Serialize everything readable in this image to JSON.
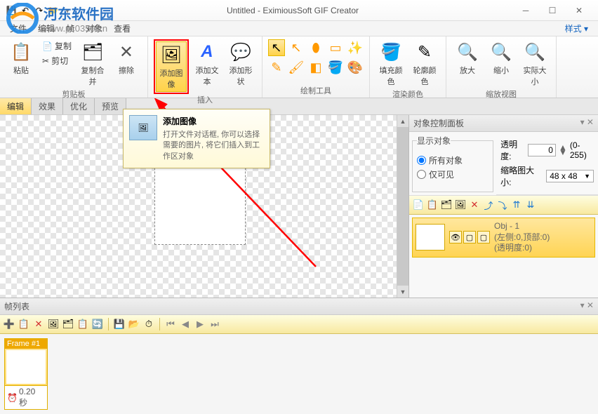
{
  "window": {
    "title": "Untitled - EximiousSoft GIF Creator",
    "style_menu": "样式 ▾"
  },
  "watermark": {
    "site": "河东软件园",
    "url": "www.pc0359.cn"
  },
  "menu": {
    "file": "文件",
    "edit": "编辑",
    "frame": "帧",
    "object": "对象",
    "view": "查看"
  },
  "ribbon": {
    "paste": "粘贴",
    "copy": "复制",
    "cut": "剪切",
    "merge": "复制合并",
    "clear": "擦除",
    "add_image": "添加图像",
    "add_text": "添加文本",
    "add_shape": "添加形状",
    "fill_color": "填充颜色",
    "outline_color": "轮廓颜色",
    "zoom_in": "放大",
    "zoom_out": "缩小",
    "actual_size": "实际大小",
    "group_clipboard": "剪贴板",
    "group_insert": "插入",
    "group_draw": "绘制工具",
    "group_color": "渲染颜色",
    "group_zoom": "缩放视图"
  },
  "tabs": {
    "edit": "编辑",
    "effect": "效果",
    "optimize": "优化",
    "preview": "预览"
  },
  "tooltip": {
    "title": "添加图像",
    "desc": "打开文件对话框, 你可以选择需要的图片, 将它们插入到工作区对象"
  },
  "right_panel": {
    "title": "对象控制面板",
    "show_objects": "显示对象",
    "all_objects": "所有对象",
    "only_visible": "仅可见",
    "opacity_label": "透明度:",
    "opacity_value": "0",
    "opacity_range": "(0-255)",
    "thumb_size_label": "缩略图大小:",
    "thumb_size_value": "48 x 48",
    "obj_name": "Obj - 1",
    "obj_pos": "(左侧:0,顶部:0)",
    "obj_opacity": "(透明度:0)"
  },
  "frames": {
    "header": "帧列表",
    "f1_name": "Frame #1",
    "f1_time": "0.20 秒"
  }
}
